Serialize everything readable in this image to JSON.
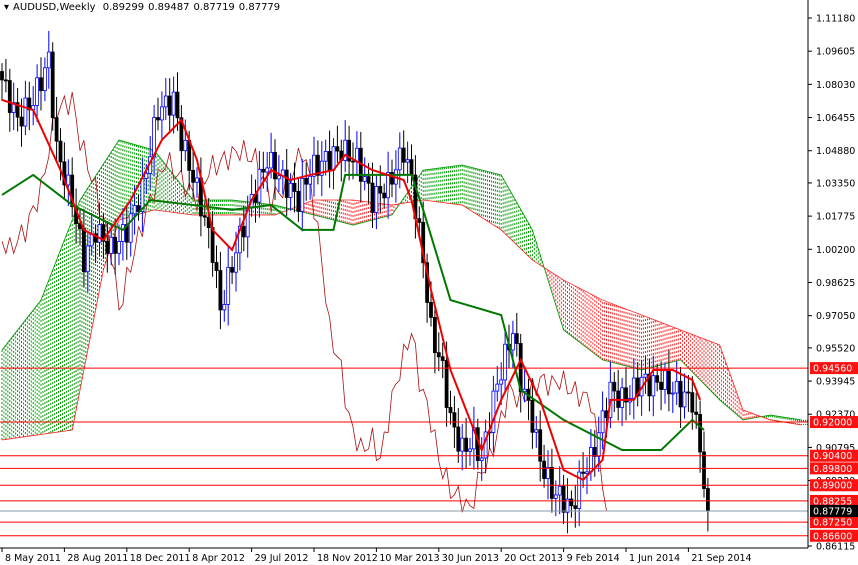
{
  "header": {
    "symbol_timeframe": "AUDUSD,Weekly",
    "open": "0.89299",
    "high": "0.89487",
    "low": "0.87719",
    "close": "0.87779"
  },
  "colors": {
    "bull": "#0000ff",
    "bear": "#000000",
    "tenkan": "#ee0000",
    "kijun": "#007700",
    "chikou": "#aa1111",
    "cloud_up": "#009900",
    "cloud_down": "#ff2020",
    "level": "#ff0000",
    "current": "#8899aa"
  },
  "chart_data": {
    "type": "candlestick",
    "title": "AUDUSD,Weekly",
    "ylim": [
      0.86115,
      1.1118
    ],
    "x_unit": "weeks since 8 May 2011",
    "xlim": [
      0,
      207
    ],
    "y_ticks": [
      "1.11180",
      "1.09605",
      "1.08030",
      "1.06455",
      "1.04880",
      "1.03350",
      "1.01775",
      "1.00200",
      "0.98625",
      "0.97050",
      "0.95520",
      "0.93945",
      "0.92370",
      "0.90795",
      "0.89220",
      "0.86115"
    ],
    "x_ticks": [
      {
        "week": 0,
        "label": "8 May 2011"
      },
      {
        "week": 16,
        "label": "28 Aug 2011"
      },
      {
        "week": 32,
        "label": "18 Dec 2011"
      },
      {
        "week": 48,
        "label": "8 Apr 2012"
      },
      {
        "week": 64,
        "label": "29 Jul 2012"
      },
      {
        "week": 80,
        "label": "18 Nov 2012"
      },
      {
        "week": 96,
        "label": "10 Mar 2013"
      },
      {
        "week": 112,
        "label": "30 Jun 2013"
      },
      {
        "week": 128,
        "label": "20 Oct 2013"
      },
      {
        "week": 144,
        "label": "9 Feb 2014"
      },
      {
        "week": 160,
        "label": "1 Jun 2014"
      },
      {
        "week": 176,
        "label": "21 Sep 2014"
      }
    ],
    "closes": [
      [
        0,
        1.0824
      ],
      [
        4,
        1.0634
      ],
      [
        8,
        1.0729
      ],
      [
        12,
        1.0919
      ],
      [
        14,
        1.0491
      ],
      [
        18,
        1.0254
      ],
      [
        21,
        0.9969
      ],
      [
        24,
        1.0112
      ],
      [
        28,
        1.0017
      ],
      [
        32,
        1.0112
      ],
      [
        36,
        1.0302
      ],
      [
        40,
        1.0681
      ],
      [
        44,
        1.0729
      ],
      [
        46,
        1.0539
      ],
      [
        50,
        1.0302
      ],
      [
        54,
        1.0017
      ],
      [
        56,
        0.9732
      ],
      [
        60,
        1.0017
      ],
      [
        64,
        1.0254
      ],
      [
        68,
        1.0444
      ],
      [
        72,
        1.0349
      ],
      [
        76,
        1.0254
      ],
      [
        79,
        1.0396
      ],
      [
        83,
        1.0444
      ],
      [
        87,
        1.0491
      ],
      [
        91,
        1.0444
      ],
      [
        95,
        1.0254
      ],
      [
        99,
        1.0325
      ],
      [
        103,
        1.0491
      ],
      [
        105,
        1.0349
      ],
      [
        108,
        0.9969
      ],
      [
        110,
        0.9637
      ],
      [
        113,
        0.9447
      ],
      [
        115,
        0.921
      ],
      [
        118,
        0.9067
      ],
      [
        121,
        0.9115
      ],
      [
        123,
        0.902
      ],
      [
        126,
        0.9305
      ],
      [
        128,
        0.9447
      ],
      [
        131,
        0.9637
      ],
      [
        133,
        0.94
      ],
      [
        136,
        0.921
      ],
      [
        138,
        0.902
      ],
      [
        141,
        0.8877
      ],
      [
        144,
        0.883
      ],
      [
        146,
        0.8782
      ],
      [
        149,
        0.8972
      ],
      [
        151,
        0.902
      ],
      [
        154,
        0.921
      ],
      [
        156,
        0.9352
      ],
      [
        159,
        0.9305
      ],
      [
        162,
        0.9352
      ],
      [
        164,
        0.94
      ],
      [
        167,
        0.9376
      ],
      [
        169,
        0.94
      ],
      [
        172,
        0.9352
      ],
      [
        174,
        0.9328
      ],
      [
        177,
        0.9305
      ],
      [
        179,
        0.9067
      ],
      [
        181,
        0.87779
      ]
    ],
    "tenkan": [
      [
        0,
        1.0729
      ],
      [
        8,
        1.0681
      ],
      [
        15,
        1.0396
      ],
      [
        21,
        1.0112
      ],
      [
        26,
        1.0064
      ],
      [
        33,
        1.0254
      ],
      [
        41,
        1.0539
      ],
      [
        46,
        1.0634
      ],
      [
        50,
        1.0444
      ],
      [
        54,
        1.0112
      ],
      [
        59,
        1.0017
      ],
      [
        64,
        1.0254
      ],
      [
        69,
        1.0396
      ],
      [
        74,
        1.0349
      ],
      [
        79,
        1.0373
      ],
      [
        85,
        1.0396
      ],
      [
        88,
        1.0468
      ],
      [
        95,
        1.0396
      ],
      [
        103,
        1.0349
      ],
      [
        105,
        1.0254
      ],
      [
        110,
        0.9827
      ],
      [
        115,
        0.9447
      ],
      [
        121,
        0.9162
      ],
      [
        123,
        0.9067
      ],
      [
        128,
        0.9305
      ],
      [
        133,
        0.9495
      ],
      [
        138,
        0.9305
      ],
      [
        144,
        0.8972
      ],
      [
        149,
        0.8925
      ],
      [
        154,
        0.902
      ],
      [
        156,
        0.9305
      ],
      [
        162,
        0.9305
      ],
      [
        167,
        0.9447
      ],
      [
        172,
        0.9447
      ],
      [
        177,
        0.94
      ],
      [
        179,
        0.9305
      ]
    ],
    "kijun": [
      [
        0,
        1.0278
      ],
      [
        8,
        1.0373
      ],
      [
        18,
        1.023
      ],
      [
        31,
        1.0112
      ],
      [
        38,
        1.0254
      ],
      [
        49,
        1.023
      ],
      [
        59,
        1.0207
      ],
      [
        69,
        1.023
      ],
      [
        77,
        1.0112
      ],
      [
        85,
        1.0112
      ],
      [
        88,
        1.0373
      ],
      [
        105,
        1.0373
      ],
      [
        108,
        1.0207
      ],
      [
        115,
        0.9779
      ],
      [
        128,
        0.9708
      ],
      [
        133,
        0.9352
      ],
      [
        144,
        0.921
      ],
      [
        159,
        0.9067
      ],
      [
        169,
        0.9067
      ],
      [
        177,
        0.921
      ],
      [
        180,
        0.9162
      ]
    ],
    "senkou_a": [
      [
        0,
        0.9542
      ],
      [
        10,
        0.9779
      ],
      [
        20,
        1.0254
      ],
      [
        30,
        1.0539
      ],
      [
        39,
        1.0491
      ],
      [
        49,
        1.0254
      ],
      [
        59,
        1.0254
      ],
      [
        70,
        1.023
      ],
      [
        80,
        1.0183
      ],
      [
        90,
        1.0135
      ],
      [
        100,
        1.0183
      ],
      [
        108,
        1.0396
      ],
      [
        118,
        1.042
      ],
      [
        128,
        1.0373
      ],
      [
        136,
        1.0112
      ],
      [
        144,
        0.9637
      ],
      [
        154,
        0.9495
      ],
      [
        164,
        0.9447
      ],
      [
        174,
        0.9495
      ],
      [
        184,
        0.9305
      ],
      [
        190,
        0.921
      ],
      [
        197,
        0.9233
      ],
      [
        205,
        0.921
      ]
    ],
    "senkou_b": [
      [
        0,
        0.9115
      ],
      [
        18,
        0.9162
      ],
      [
        26,
        0.9922
      ],
      [
        30,
        1.0159
      ],
      [
        39,
        1.0207
      ],
      [
        49,
        1.0183
      ],
      [
        59,
        1.0183
      ],
      [
        70,
        1.0183
      ],
      [
        80,
        1.0254
      ],
      [
        90,
        1.0254
      ],
      [
        100,
        1.023
      ],
      [
        108,
        1.0254
      ],
      [
        118,
        1.023
      ],
      [
        128,
        1.0112
      ],
      [
        136,
        0.9969
      ],
      [
        144,
        0.9874
      ],
      [
        154,
        0.9779
      ],
      [
        164,
        0.9708
      ],
      [
        174,
        0.9637
      ],
      [
        184,
        0.9566
      ],
      [
        190,
        0.9257
      ],
      [
        197,
        0.921
      ],
      [
        205,
        0.9186
      ]
    ],
    "chikou_shift_weeks": 26,
    "levels": [
      "0.94560",
      "0.92000",
      "0.90400",
      "0.89800",
      "0.89000",
      "0.88255",
      "0.87250",
      "0.86600"
    ],
    "current_price": "0.87779"
  }
}
